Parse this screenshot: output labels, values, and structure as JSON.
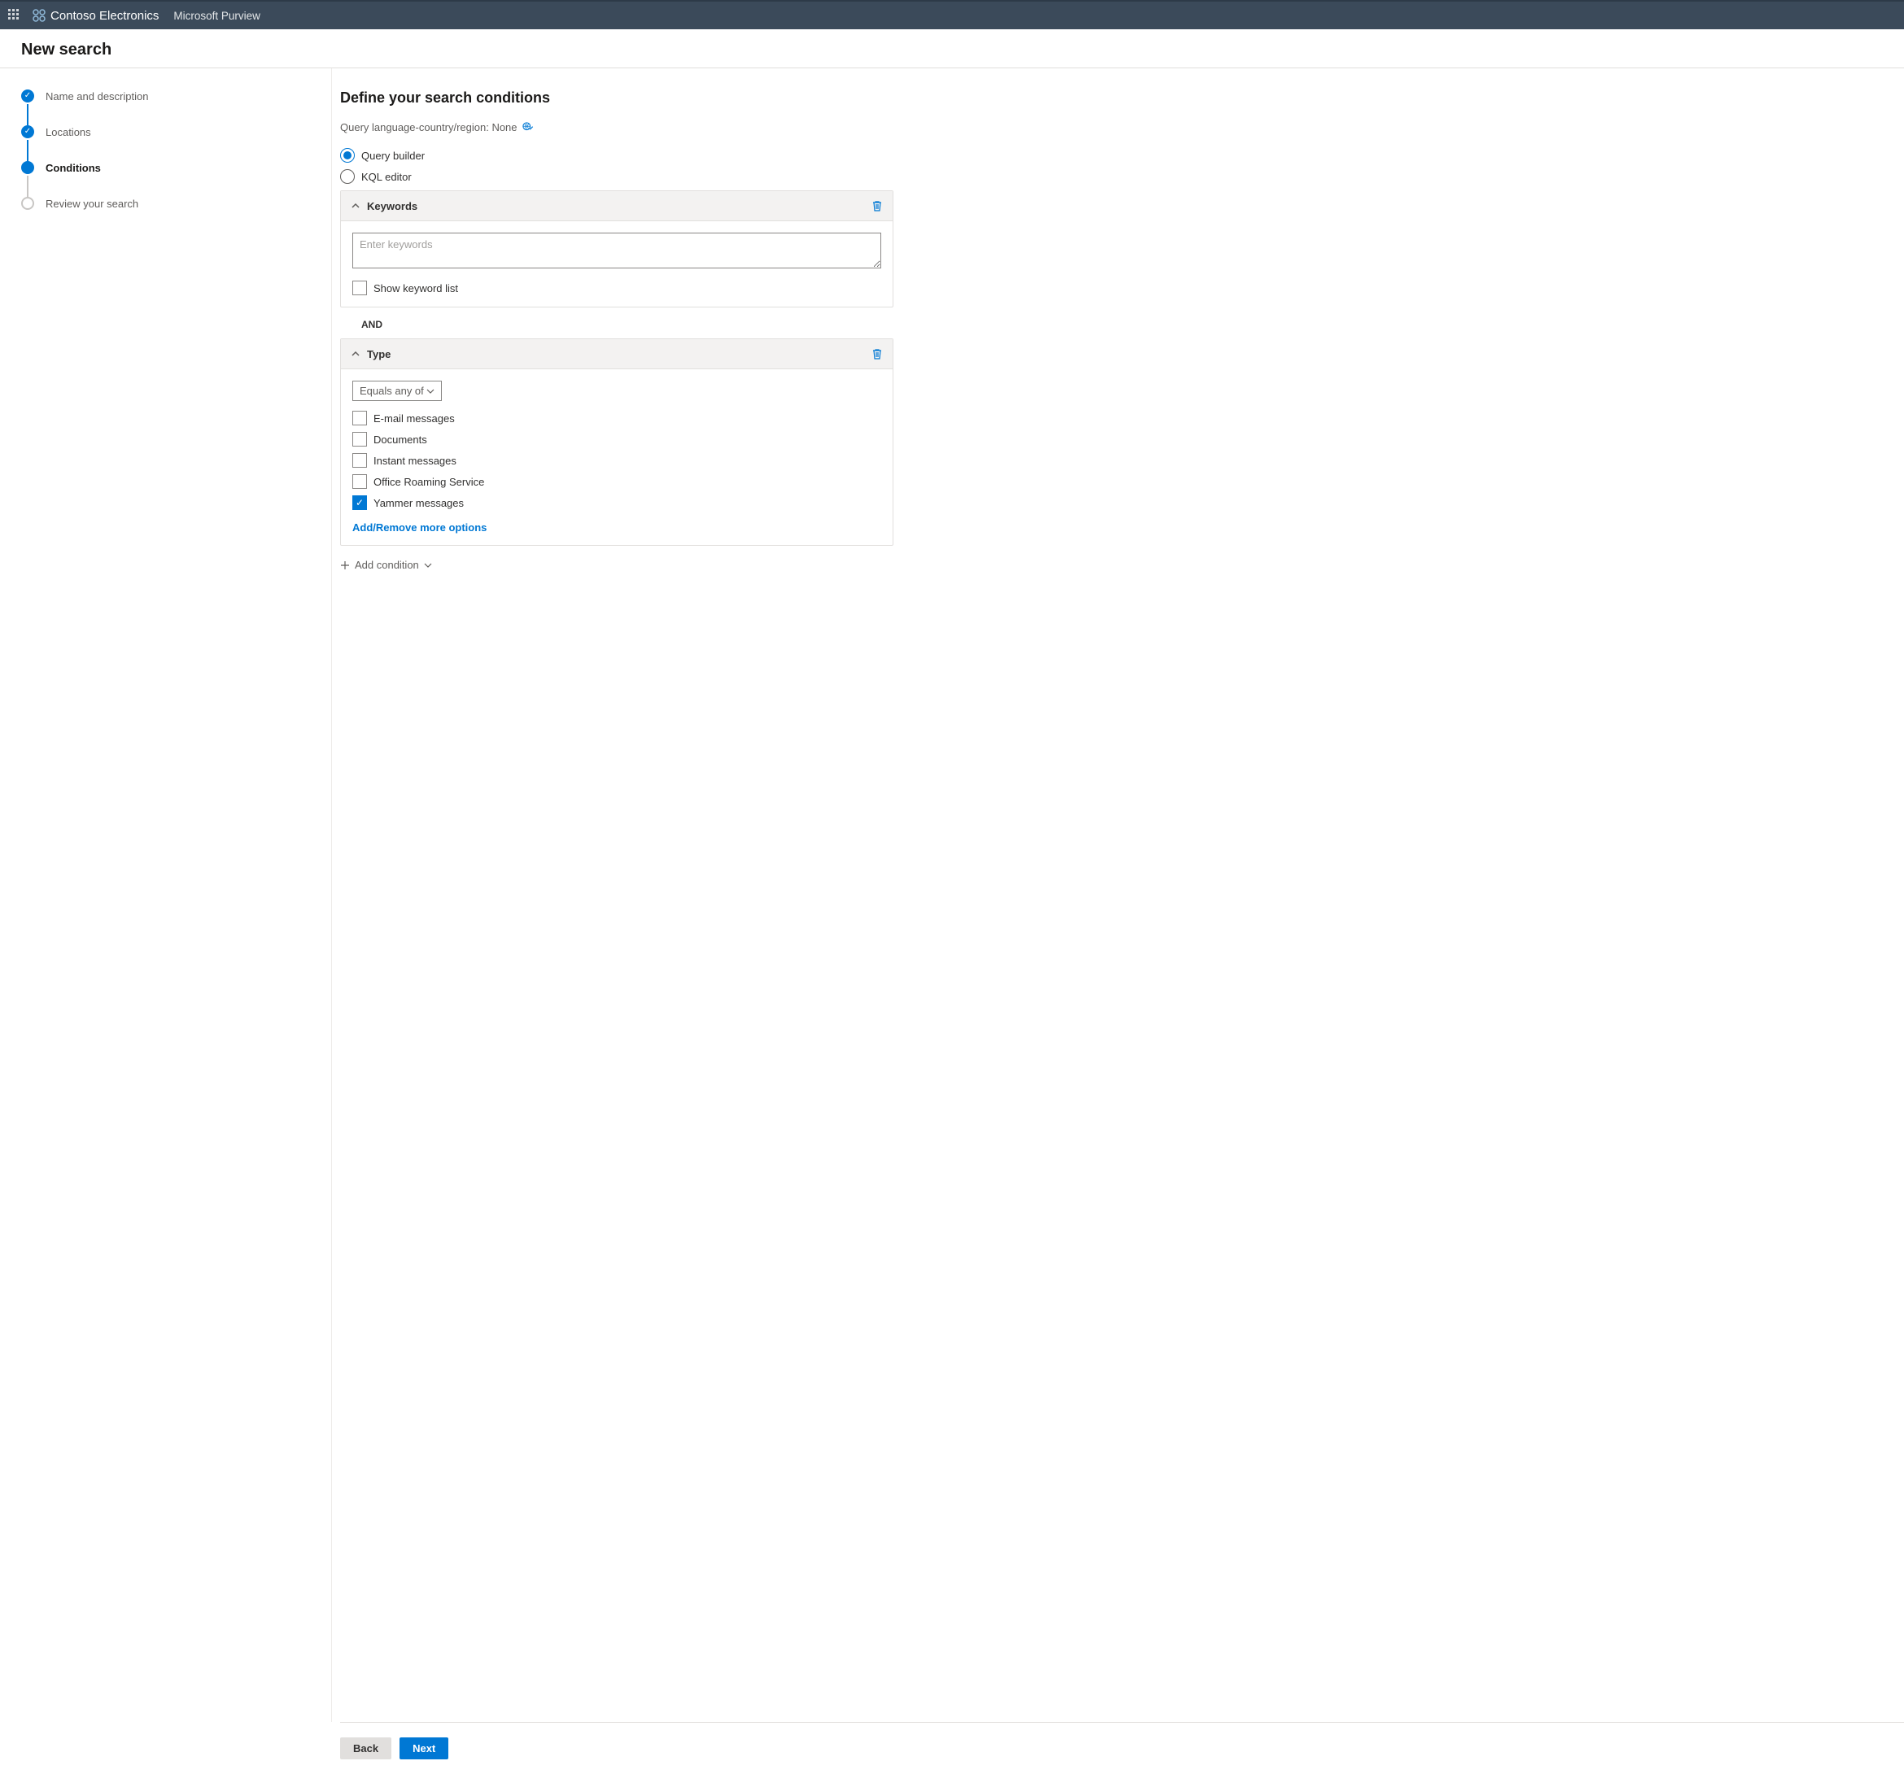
{
  "topbar": {
    "org_name": "Contoso Electronics",
    "app_name": "Microsoft Purview"
  },
  "page_title": "New search",
  "steps": [
    {
      "label": "Name and description",
      "state": "done"
    },
    {
      "label": "Locations",
      "state": "done"
    },
    {
      "label": "Conditions",
      "state": "active"
    },
    {
      "label": "Review your search",
      "state": "pending"
    }
  ],
  "main": {
    "title": "Define your search conditions",
    "query_lang_label": "Query language-country/region: None",
    "radios": {
      "query_builder": "Query builder",
      "kql_editor": "KQL editor",
      "selected": "query_builder"
    },
    "keywords_card": {
      "title": "Keywords",
      "placeholder": "Enter keywords",
      "value": "",
      "show_keyword_list_label": "Show keyword list",
      "show_keyword_list_checked": false
    },
    "operator": "AND",
    "type_card": {
      "title": "Type",
      "operator_select": "Equals any of",
      "options": [
        {
          "label": "E-mail messages",
          "checked": false
        },
        {
          "label": "Documents",
          "checked": false
        },
        {
          "label": "Instant messages",
          "checked": false
        },
        {
          "label": "Office Roaming Service",
          "checked": false
        },
        {
          "label": "Yammer messages",
          "checked": true
        }
      ],
      "more_options_link": "Add/Remove more options"
    },
    "add_condition_label": "Add condition"
  },
  "footer": {
    "back": "Back",
    "next": "Next"
  }
}
